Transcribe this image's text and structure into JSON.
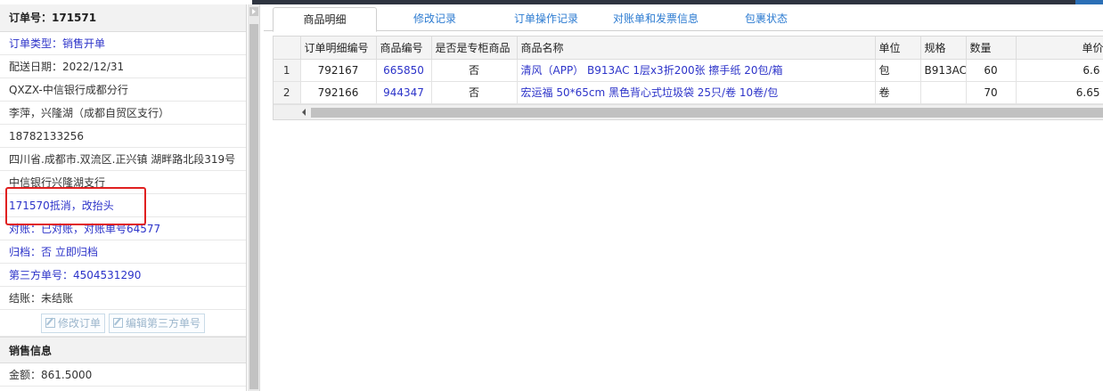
{
  "order": {
    "header": "订单号：171571",
    "rows": [
      {
        "text": "订单类型：销售开单",
        "style": "blue"
      },
      {
        "text": "配送日期：2022/12/31",
        "style": "plain"
      },
      {
        "text": "QXZX-中信银行成都分行",
        "style": "plain"
      },
      {
        "text": "李萍，兴隆湖（成都自贸区支行）",
        "style": "plain"
      },
      {
        "text": "18782133256",
        "style": "plain"
      },
      {
        "text": "四川省.成都市.双流区.正兴镇 湖畔路北段319号",
        "style": "plain"
      },
      {
        "text": "中信银行兴隆湖支行",
        "style": "plain"
      },
      {
        "text": "171570抵消，改抬头",
        "style": "blue"
      },
      {
        "text": "对账：已对账，对账单号64577",
        "style": "blue"
      },
      {
        "text": "归档：否 立即归档",
        "style": "blue"
      },
      {
        "text": "第三方单号：4504531290",
        "style": "blue"
      },
      {
        "text": "结账：未结账",
        "style": "plain"
      }
    ],
    "buttons": {
      "edit_order": "修改订单",
      "edit_third": "编辑第三方单号"
    }
  },
  "sales": {
    "header": "销售信息",
    "amount": "金额：861.5000"
  },
  "tabs": [
    "商品明细",
    "修改记录",
    "订单操作记录",
    "对账单和发票信息",
    "包裹状态"
  ],
  "active_tab": 0,
  "table": {
    "columns": [
      "",
      "订单明细编号",
      "商品编号",
      "是否是专柜商品",
      "商品名称",
      "单位",
      "规格",
      "数量",
      "单价"
    ],
    "rows": [
      [
        "1",
        "792167",
        "665850",
        "否",
        "清风（APP） B913AC 1层x3折200张 擦手纸 20包/箱",
        "包",
        "B913AC",
        "60",
        "6.6"
      ],
      [
        "2",
        "792166",
        "944347",
        "否",
        "宏运福 50*65cm 黑色背心式垃圾袋 25只/卷 10卷/包",
        "卷",
        "",
        "70",
        "6.65"
      ]
    ]
  },
  "colors": {
    "link": "#2c33c9",
    "tab_link": "#2c7bd1",
    "highlight_box": "#e02020"
  }
}
